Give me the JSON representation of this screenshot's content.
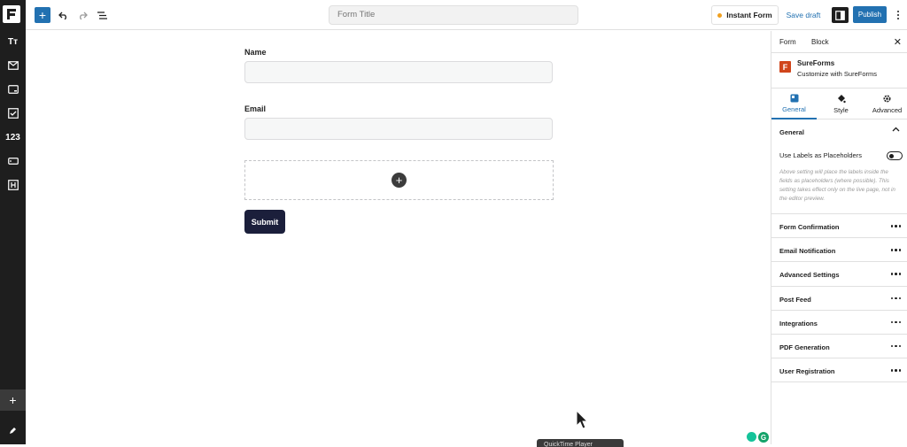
{
  "topbar": {
    "add_symbol": "+",
    "form_title_placeholder": "Form Title",
    "instant_form_label": "Instant Form",
    "save_draft_label": "Save draft",
    "publish_label": "Publish"
  },
  "rail": {
    "items": [
      {
        "icon": "text-type-icon",
        "label": "Tт"
      },
      {
        "icon": "mail-icon",
        "label": ""
      },
      {
        "icon": "card-icon",
        "label": ""
      },
      {
        "icon": "checkbox-icon",
        "label": ""
      },
      {
        "icon": "number-icon",
        "label": "123"
      },
      {
        "icon": "input-icon",
        "label": ""
      },
      {
        "icon": "heading-icon",
        "label": ""
      }
    ],
    "add_symbol": "+"
  },
  "form": {
    "fields": [
      {
        "label": "Name",
        "value": ""
      },
      {
        "label": "Email",
        "value": ""
      }
    ],
    "appender_symbol": "+",
    "submit_label": "Submit"
  },
  "sidebar": {
    "tabs": [
      "Form",
      "Block"
    ],
    "close_symbol": "✕",
    "brand_name": "SureForms",
    "brand_sub": "Customize with SureForms",
    "brand_letter": "F",
    "subtabs": [
      "General",
      "Style",
      "Advanced"
    ],
    "active_subtab": "General",
    "general_title": "General",
    "toggle_label": "Use Labels as Placeholders",
    "toggle_on": false,
    "help_text": "Above setting will place the labels inside the fields as placeholders (where possible). This setting takes effect only on the live page, not in the editor preview.",
    "sections": [
      "Form Confirmation",
      "Email Notification",
      "Advanced Settings",
      "Post Feed",
      "Integrations",
      "PDF Generation",
      "User Registration"
    ]
  },
  "overlay": {
    "tooltip_text": "QuickTime Player",
    "grammarly_letter": "G"
  },
  "colors": {
    "accent": "#2271b1",
    "rail": "#1e1e1e",
    "submit": "#1b1f3b",
    "brand": "#d0451b"
  }
}
